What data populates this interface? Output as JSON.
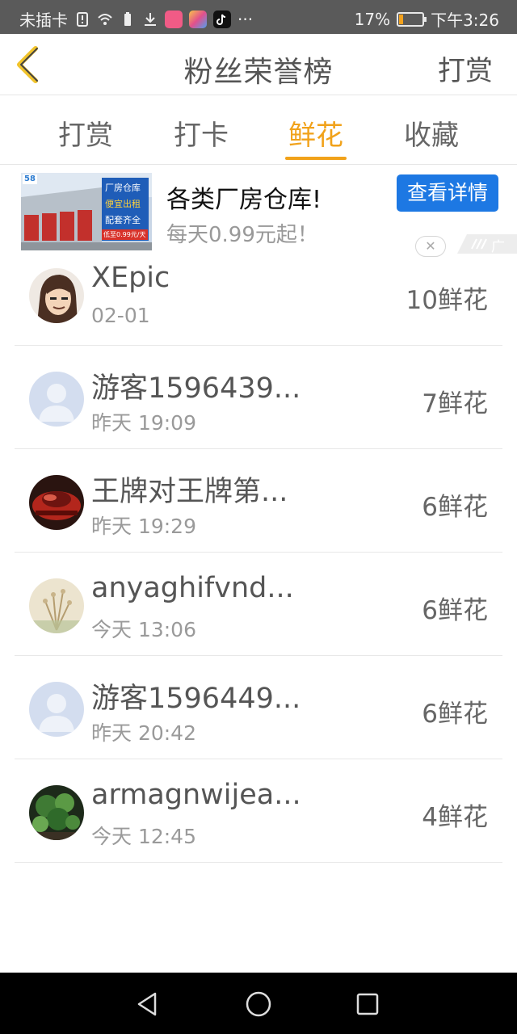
{
  "status_bar": {
    "carrier": "未插卡",
    "battery_percent": "17%",
    "battery_level": 0.17,
    "time": "下午3:26",
    "more_indicator": "···",
    "icons": [
      "sim-alert-icon",
      "wifi-icon",
      "battery-saver-icon",
      "download-icon",
      "app-icon-pink",
      "app-icon-gradient",
      "tiktok-icon"
    ]
  },
  "header": {
    "title": "粉丝荣誉榜",
    "action_label": "打赏",
    "back_icon": "chevron-left-icon"
  },
  "tabs": [
    {
      "label": "打赏",
      "active": false
    },
    {
      "label": "打卡",
      "active": false
    },
    {
      "label": "鲜花",
      "active": true
    },
    {
      "label": "收藏",
      "active": false
    }
  ],
  "ad": {
    "title": "各类厂房仓库!",
    "subtitle": "每天0.99元起！",
    "button_label": "查看详情",
    "close_symbol": "✕",
    "tag_label": "广告",
    "image_texts": {
      "logo": "58",
      "line1": "厂房仓库",
      "line2": "便宜出租",
      "line3": "配套齐全",
      "price": "低至0.99元/天"
    }
  },
  "list": [
    {
      "name": "XEpic",
      "time": "02-01",
      "count": "10鲜花",
      "avatar": "cartoon"
    },
    {
      "name": "游客1596439...",
      "time": "昨天 19:09",
      "count": "7鲜花",
      "avatar": "default"
    },
    {
      "name": "王牌对王牌第...",
      "time": "昨天 19:29",
      "count": "6鲜花",
      "avatar": "car"
    },
    {
      "name": "anyaghifvnd...",
      "time": "今天 13:06",
      "count": "6鲜花",
      "avatar": "plant"
    },
    {
      "name": "游客1596449...",
      "time": "昨天 20:42",
      "count": "6鲜花",
      "avatar": "default"
    },
    {
      "name": "armagnwijea...",
      "time": "今天 12:45",
      "count": "4鲜花",
      "avatar": "nature"
    }
  ],
  "colors": {
    "accent": "#f1a21a",
    "ad_button": "#1d78e3",
    "status_bar_bg": "#5a5a5a",
    "nav_bar_bg": "#000000"
  }
}
